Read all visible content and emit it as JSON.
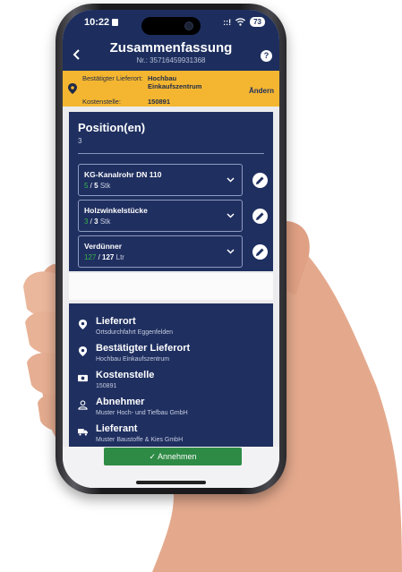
{
  "status_bar": {
    "time": "10:22",
    "signal": "::!",
    "battery": "73"
  },
  "app_bar": {
    "title": "Zusammenfassung",
    "subtitle": "Nr.: 35716459931368",
    "help_label": "?"
  },
  "banner": {
    "confirmed_location_label": "Bestätigter Lieferort:",
    "confirmed_location_value_line1": "Hochbau",
    "confirmed_location_value_line2": "Einkaufszentrum",
    "cost_center_label": "Kostenstelle:",
    "cost_center_value": "150891",
    "change_label": "Ändern",
    "color": "#f4b630"
  },
  "positions": {
    "title": "Position(en)",
    "count": "3",
    "items": [
      {
        "name": "KG-Kanalrohr DN 110",
        "current": "5",
        "total": "5",
        "unit": "Stk"
      },
      {
        "name": "Holzwinkelstücke",
        "current": "3",
        "total": "3",
        "unit": "Stk"
      },
      {
        "name": "Verdünner",
        "current": "127",
        "total": "127",
        "unit": "Ltr"
      }
    ]
  },
  "details": [
    {
      "title": "Lieferort",
      "value": "Ortsdurchfahrt Eggenfelden",
      "icon": "map-pin-icon"
    },
    {
      "title": "Bestätigter Lieferort",
      "value": "Hochbau Einkaufszentrum",
      "icon": "map-pin-icon"
    },
    {
      "title": "Kostenstelle",
      "value": "150891",
      "icon": "money-icon"
    },
    {
      "title": "Abnehmer",
      "value": "Muster Hoch- und Tiefbau GmbH",
      "icon": "person-icon"
    },
    {
      "title": "Lieferant",
      "value": "Muster Baustoffe & Kies GmbH",
      "icon": "truck-icon"
    }
  ],
  "accept_button": {
    "label": "✓ Annehmen",
    "color": "#2e8b45"
  },
  "colors": {
    "navy": "#1d2e5e",
    "card": "#1f2f60",
    "quantity_green": "#39b54a"
  }
}
